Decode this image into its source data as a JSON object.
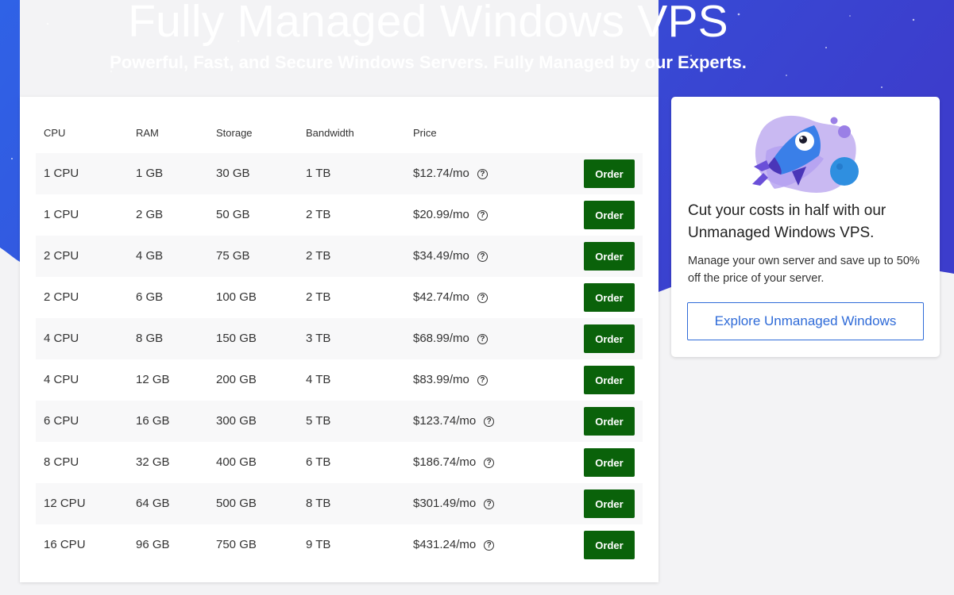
{
  "hero": {
    "title": "Fully Managed Windows VPS",
    "subtitle": "Powerful, Fast, and Secure Windows Servers. Fully Managed by our Experts."
  },
  "table": {
    "headers": {
      "cpu": "CPU",
      "ram": "RAM",
      "storage": "Storage",
      "bandwidth": "Bandwidth",
      "price": "Price"
    },
    "order_label": "Order",
    "info_icon": "question-circle-icon",
    "rows": [
      {
        "cpu": "1 CPU",
        "ram": "1 GB",
        "storage": "30 GB",
        "bandwidth": "1 TB",
        "price": "$12.74/mo"
      },
      {
        "cpu": "1 CPU",
        "ram": "2 GB",
        "storage": "50 GB",
        "bandwidth": "2 TB",
        "price": "$20.99/mo"
      },
      {
        "cpu": "2 CPU",
        "ram": "4 GB",
        "storage": "75 GB",
        "bandwidth": "2 TB",
        "price": "$34.49/mo"
      },
      {
        "cpu": "2 CPU",
        "ram": "6 GB",
        "storage": "100 GB",
        "bandwidth": "2 TB",
        "price": "$42.74/mo"
      },
      {
        "cpu": "4 CPU",
        "ram": "8 GB",
        "storage": "150 GB",
        "bandwidth": "3 TB",
        "price": "$68.99/mo"
      },
      {
        "cpu": "4 CPU",
        "ram": "12 GB",
        "storage": "200 GB",
        "bandwidth": "4 TB",
        "price": "$83.99/mo"
      },
      {
        "cpu": "6 CPU",
        "ram": "16 GB",
        "storage": "300 GB",
        "bandwidth": "5 TB",
        "price": "$123.74/mo"
      },
      {
        "cpu": "8 CPU",
        "ram": "32 GB",
        "storage": "400 GB",
        "bandwidth": "6 TB",
        "price": "$186.74/mo"
      },
      {
        "cpu": "12 CPU",
        "ram": "64 GB",
        "storage": "500 GB",
        "bandwidth": "8 TB",
        "price": "$301.49/mo"
      },
      {
        "cpu": "16 CPU",
        "ram": "96 GB",
        "storage": "750 GB",
        "bandwidth": "9 TB",
        "price": "$431.24/mo"
      }
    ]
  },
  "promo": {
    "illustration": "rocket-icon",
    "title": "Cut your costs in half with our Unmanaged Windows VPS.",
    "text": "Manage your own server and save up to 50% off the price of your server.",
    "button_label": "Explore Unmanaged Windows"
  },
  "colors": {
    "hero_gradient_start": "#2f5fe3",
    "hero_gradient_end": "#3b3fcf",
    "order_button": "#0a620a",
    "explore_button_border": "#2f6bd8",
    "page_background": "#f3f3f5"
  }
}
